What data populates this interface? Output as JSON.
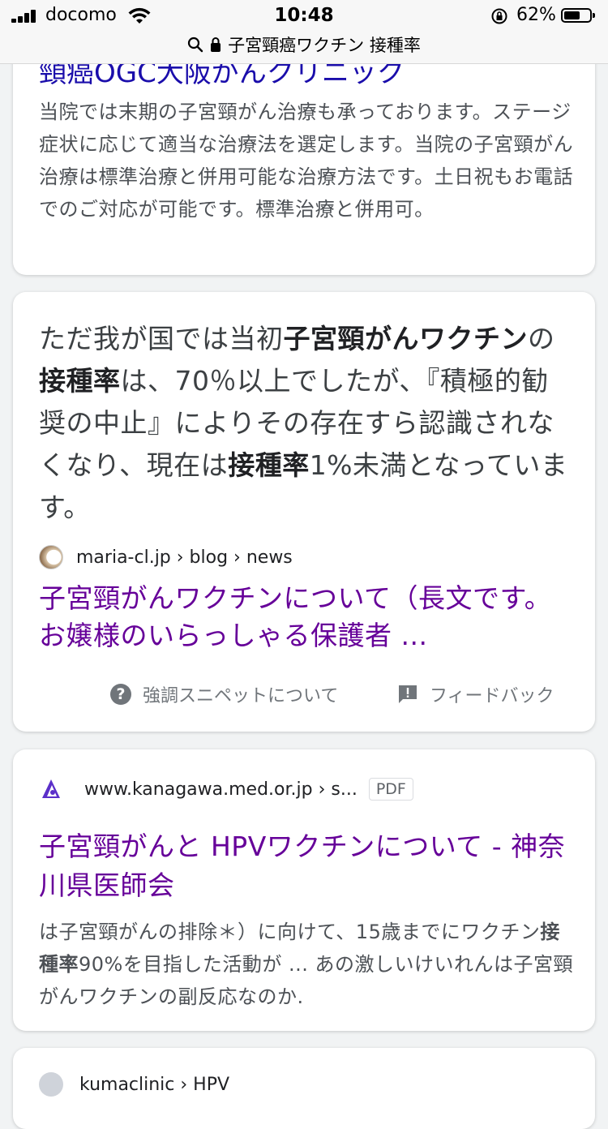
{
  "status_bar": {
    "carrier": "docomo",
    "time": "10:48",
    "battery_percent": "62%",
    "battery_level": 0.62
  },
  "url_bar": {
    "query": "子宮頸癌ワクチン 接種率"
  },
  "results": [
    {
      "title": "頸癌OGC大阪がんクリニック",
      "snippet": "当院では末期の子宮頸がん治療も承っております。ステージ症状に応じて適当な治療法を選定します。当院の子宮頸がん治療は標準治療と併用可能な治療方法です。土日祝もお電話でのご対応が可能です。標準治療と併用可。"
    },
    {
      "featured_snippet": {
        "t1": "ただ我が国では当初",
        "b1": "子宮頸がんワクチン",
        "t2": "の",
        "b2": "接種率",
        "t3": "は、70％以上でしたが、『積極的勧奨の中止』によりその存在すら認識されなくなり、現在は",
        "b3": "接種率",
        "t4": "1%未満となっています。"
      },
      "cite": "maria-cl.jp › blog › news",
      "title": "子宮頸がんワクチンについて（長文です。お嬢様のいらっしゃる保護者 ...",
      "about_label": "強調スニペットについて",
      "feedback_label": "フィードバック"
    },
    {
      "cite": "www.kanagawa.med.or.jp › s...",
      "badge": "PDF",
      "title": "子宮頸がんと HPVワクチンについて - 神奈川県医師会",
      "snippet": {
        "t1": "は子宮頸がんの排除＊）に向けて、15歳までにワクチン",
        "b1": "接種率",
        "t2": "90%を目指した活動が ... あの激しいけいれんは子宮頸がんワクチンの副反応なのか."
      }
    },
    {
      "cite": "kumaclinic › HPV"
    }
  ],
  "colors": {
    "link_unvisited": "#1a0dab",
    "link_visited": "#660099",
    "snippet_text": "#4d5156",
    "page_bg": "#f1f3f4"
  },
  "icons": {
    "search": "search-icon",
    "lock": "lock-icon",
    "help": "help-icon",
    "feedback": "feedback-icon"
  }
}
